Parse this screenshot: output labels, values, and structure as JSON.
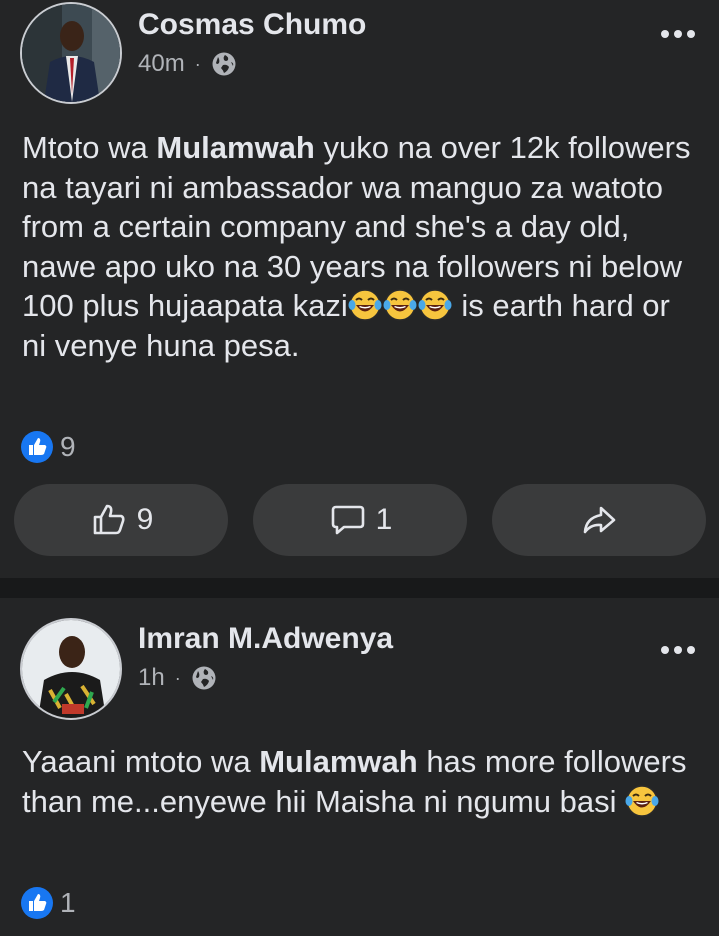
{
  "post1": {
    "author": "Cosmas Chumo",
    "time": "40m",
    "dot": "·",
    "text": {
      "seg1": "Mtoto wa ",
      "bold1": "Mulamwah",
      "seg2": " yuko na over 12k followers na tayari ni ambassador wa manguo za watoto from a certain company and she's a day old, nawe apo uko na 30 years na followers ni below 100 plus hujaapata kazi",
      "seg3": " is earth hard or ni venye huna pesa."
    },
    "emojis": [
      "laughing-tears-icon",
      "laughing-tears-icon",
      "laughing-tears-icon"
    ],
    "reaction_count": "9",
    "actions": {
      "like_count": "9",
      "comment_count": "1"
    }
  },
  "post2": {
    "author": "Imran M.Adwenya",
    "time": "1h",
    "dot": "·",
    "text": {
      "seg1": "Yaaani mtoto wa ",
      "bold1": "Mulamwah",
      "seg2": " has more followers than me...enyewe hii Maisha ni ngumu basi "
    },
    "emojis": [
      "laughing-tears-icon"
    ],
    "reaction_count": "1"
  },
  "colors": {
    "background": "#242526",
    "separator": "#18191a",
    "button": "#3a3b3c",
    "primary_text": "#e4e6eb",
    "secondary_text": "#b0b3b8",
    "like_blue": "#1877f2"
  }
}
